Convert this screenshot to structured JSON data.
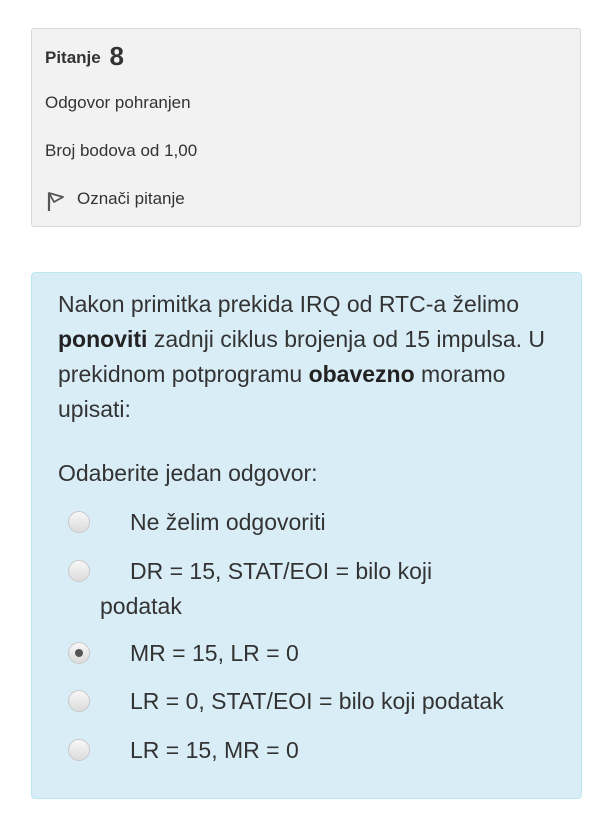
{
  "info": {
    "question_label": "Pitanje",
    "question_number": "8",
    "state": "Odgovor pohranjen",
    "grade": "Broj bodova od 1,00",
    "flag_label": "Označi pitanje"
  },
  "question": {
    "text_part1": "Nakon primitka prekida IRQ od RTC-a želimo ",
    "text_bold1": "ponoviti",
    "text_part2": " zadnji ciklus brojenja od 15 impulsa. U prekidnom potprogramu ",
    "text_bold2": "obavezno",
    "text_part3": " moramo upisati:",
    "prompt": "Odaberite jedan odgovor:",
    "answers": [
      {
        "label": "Ne želim odgovoriti",
        "checked": false
      },
      {
        "label": "DR = 15, STAT/EOI = bilo koji",
        "label_cont": "podatak",
        "checked": false
      },
      {
        "label": "MR = 15, LR = 0",
        "checked": true
      },
      {
        "label": "LR = 0, STAT/EOI = bilo koji podatak",
        "checked": false
      },
      {
        "label": "LR = 15, MR = 0",
        "checked": false
      }
    ]
  },
  "colors": {
    "info_bg": "#f2f2f2",
    "formulation_bg": "#d9edf7",
    "formulation_border": "#bce8f1"
  }
}
